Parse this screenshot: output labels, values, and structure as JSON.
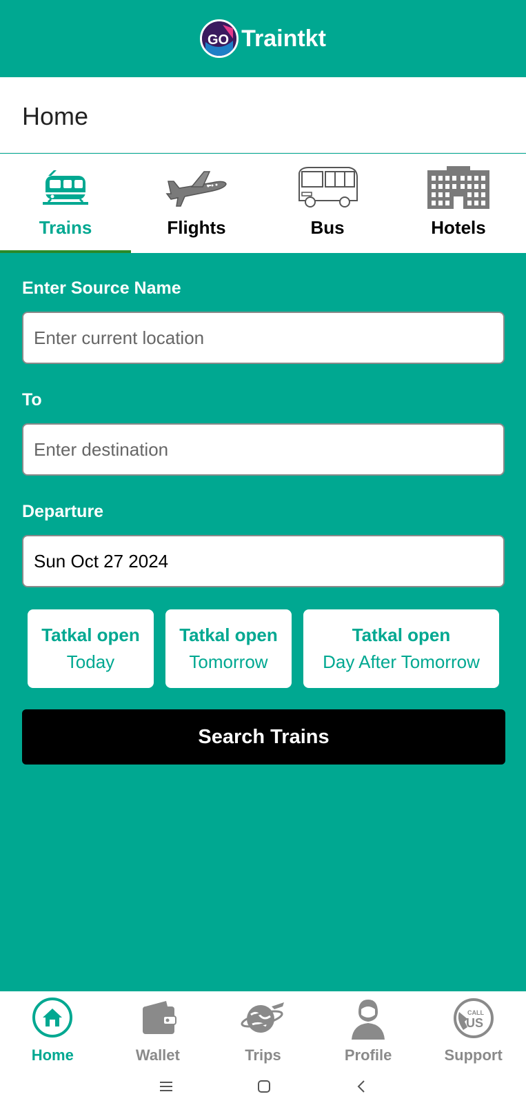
{
  "app": {
    "brand_name": "Traintkt",
    "logo_text": "GO"
  },
  "header": {
    "title": "Home"
  },
  "tabs": [
    {
      "label": "Trains",
      "icon": "train-icon",
      "active": true
    },
    {
      "label": "Flights",
      "icon": "airplane-icon",
      "active": false
    },
    {
      "label": "Bus",
      "icon": "bus-icon",
      "active": false
    },
    {
      "label": "Hotels",
      "icon": "hotel-icon",
      "active": false
    }
  ],
  "form": {
    "source": {
      "label": "Enter Source Name",
      "placeholder": "Enter current location",
      "value": ""
    },
    "destination": {
      "label": "To",
      "placeholder": "Enter destination",
      "value": ""
    },
    "departure": {
      "label": "Departure",
      "value": "Sun Oct 27 2024"
    }
  },
  "tatkal": [
    {
      "title": "Tatkal open",
      "when": "Today"
    },
    {
      "title": "Tatkal open",
      "when": "Tomorrow"
    },
    {
      "title": "Tatkal open",
      "when": "Day After Tomorrow"
    }
  ],
  "search_button": {
    "label": "Search Trains"
  },
  "bottom_nav": [
    {
      "label": "Home",
      "icon": "home-icon",
      "active": true
    },
    {
      "label": "Wallet",
      "icon": "wallet-icon",
      "active": false
    },
    {
      "label": "Trips",
      "icon": "trips-icon",
      "active": false
    },
    {
      "label": "Profile",
      "icon": "profile-icon",
      "active": false
    },
    {
      "label": "Support",
      "icon": "support-icon",
      "active": false
    }
  ],
  "colors": {
    "primary": "#00a891",
    "active_tab_underline": "#2a8a2a",
    "button": "#000000",
    "inactive": "#8a8a8a"
  }
}
